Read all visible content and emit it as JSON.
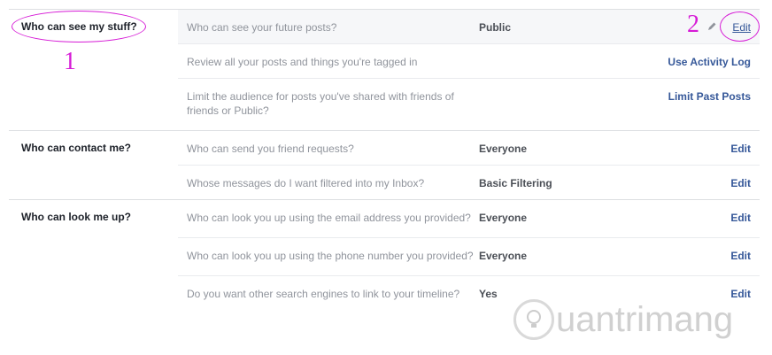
{
  "sections": [
    {
      "title": "Who can see my stuff?",
      "rows": [
        {
          "question": "Who can see your future posts?",
          "value": "Public",
          "action": "Edit"
        },
        {
          "question": "Review all your posts and things you're tagged in",
          "value": "",
          "action": "Use Activity Log"
        },
        {
          "question": "Limit the audience for posts you've shared with friends of friends or Public?",
          "value": "",
          "action": "Limit Past Posts"
        }
      ]
    },
    {
      "title": "Who can contact me?",
      "rows": [
        {
          "question": "Who can send you friend requests?",
          "value": "Everyone",
          "action": "Edit"
        },
        {
          "question": "Whose messages do I want filtered into my Inbox?",
          "value": "Basic Filtering",
          "action": "Edit"
        }
      ]
    },
    {
      "title": "Who can look me up?",
      "rows": [
        {
          "question": "Who can look you up using the email address you provided?",
          "value": "Everyone",
          "action": "Edit"
        },
        {
          "question": "Who can look you up using the phone number you provided?",
          "value": "Everyone",
          "action": "Edit"
        },
        {
          "question": "Do you want other search engines to link to your timeline?",
          "value": "Yes",
          "action": "Edit"
        }
      ]
    }
  ],
  "annotations": {
    "step1": "1",
    "step2": "2"
  },
  "watermark": {
    "text": "uantrimang"
  },
  "colors": {
    "link": "#365899",
    "annotation": "#d61bd6",
    "muted": "#90949c"
  }
}
